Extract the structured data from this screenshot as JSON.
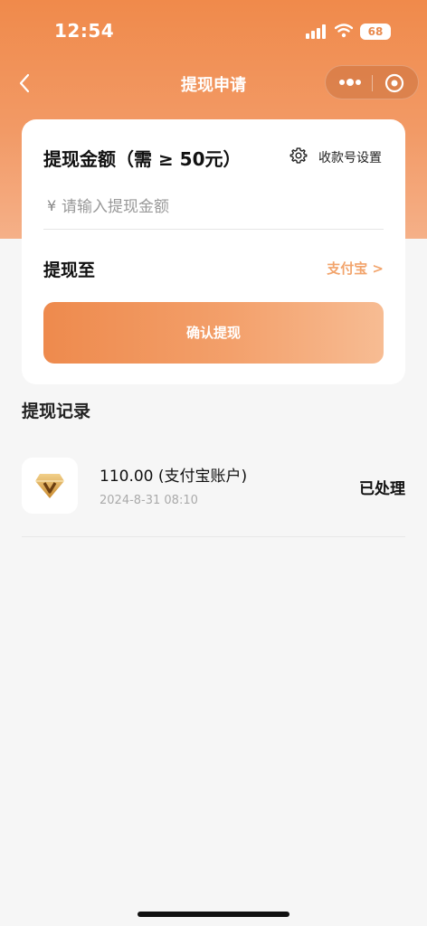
{
  "status_bar": {
    "time": "12:54",
    "battery": "68"
  },
  "nav": {
    "title": "提现申请"
  },
  "form": {
    "amount_title": "提现金额（需 ≥ 50元）",
    "account_settings_label": "收款号设置",
    "currency_symbol": "¥",
    "amount_placeholder": "请输入提现金额",
    "amount_value": "",
    "destination_label": "提现至",
    "destination_value": "支付宝 >",
    "confirm_label": "确认提现"
  },
  "records": {
    "title": "提现记录",
    "items": [
      {
        "amount": "110.00 (支付宝账户)",
        "time": "2024-8-31 08:10",
        "status": "已处理"
      }
    ]
  },
  "colors": {
    "header_gradient_top": "#f08a4b",
    "header_gradient_bottom": "#f5b088",
    "accent_text": "#f2a46c",
    "button_start": "#ee8a4d",
    "button_end": "#f7bc93"
  },
  "icons": [
    "back-icon",
    "more-icon",
    "close-circle-icon",
    "gear-icon",
    "diamond-icon"
  ]
}
